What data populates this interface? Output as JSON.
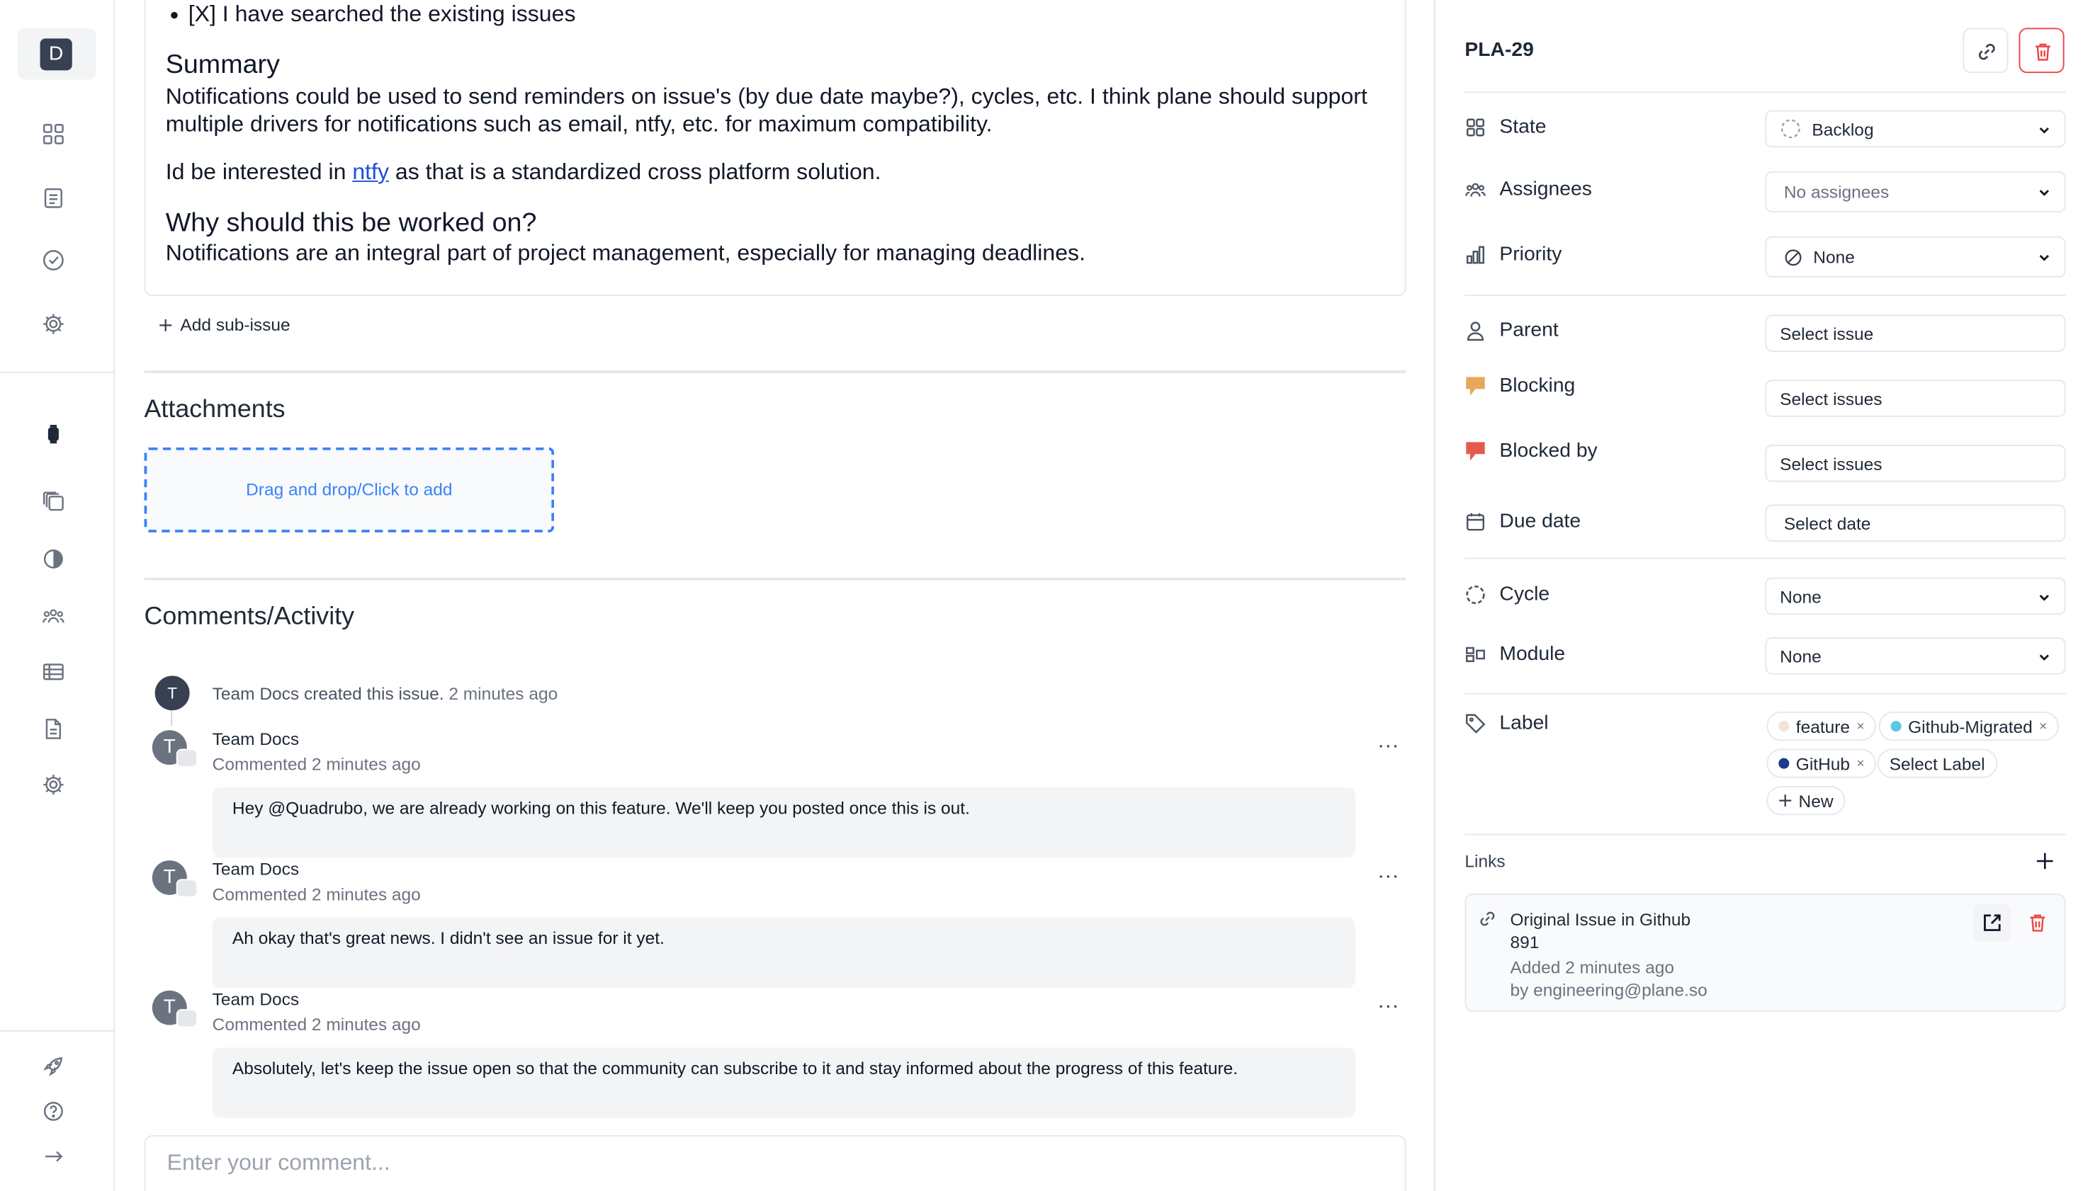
{
  "workspace": {
    "avatar_letter": "D"
  },
  "rail_icons": [
    "grid-icon",
    "clipboard-icon",
    "check-circle-icon",
    "gear-icon",
    "watch-icon",
    "layers-icon",
    "contrast-icon",
    "users-icon",
    "table-icon",
    "document-icon",
    "settings-icon",
    "rocket-icon",
    "help-icon",
    "arrow-right-icon"
  ],
  "description": {
    "checklist_item": "[X] I have searched the existing issues",
    "summary_heading": "Summary",
    "summary_text": "Notifications could be used to send reminders on issue's (by due date maybe?), cycles, etc. I think plane should support multiple drivers for notifications such as email, ntfy, etc. for maximum compatibility.",
    "interest_prefix": "Id be interested in",
    "interest_link": "ntfy",
    "interest_suffix": "as that is a standardized cross platform solution.",
    "why_heading": "Why should this be worked on?",
    "why_text": "Notifications are an integral part of project management, especially for managing deadlines."
  },
  "sub_issue": {
    "add_label": "Add sub-issue"
  },
  "attachments": {
    "heading": "Attachments",
    "dropzone_label": "Drag and drop/Click to add"
  },
  "comments": {
    "heading": "Comments/Activity",
    "activity": {
      "avatar": "T",
      "actor": "Team Docs",
      "action": "created this issue.",
      "time": "2 minutes ago"
    },
    "items": [
      {
        "avatar": "T",
        "author": "Team Docs",
        "time": "Commented 2 minutes ago",
        "body": "Hey @Quadrubo, we are already working on this feature. We'll keep you posted once this is out."
      },
      {
        "avatar": "T",
        "author": "Team Docs",
        "time": "Commented 2 minutes ago",
        "body": "Ah okay that's great news. I didn't see an issue for it yet."
      },
      {
        "avatar": "T",
        "author": "Team Docs",
        "time": "Commented 2 minutes ago",
        "body": "Absolutely, let's keep the issue open so that the community can subscribe to it and stay informed about the progress of this feature."
      }
    ],
    "more_label": "...",
    "input_placeholder": "Enter your comment..."
  },
  "sidebar": {
    "issue_id": "PLA-29",
    "properties": {
      "state": {
        "label": "State",
        "value": "Backlog"
      },
      "assignees": {
        "label": "Assignees",
        "value": "No assignees"
      },
      "priority": {
        "label": "Priority",
        "value": "None"
      },
      "parent": {
        "label": "Parent",
        "value": "Select issue"
      },
      "blocking": {
        "label": "Blocking",
        "value": "Select issues"
      },
      "blocked_by": {
        "label": "Blocked by",
        "value": "Select issues"
      },
      "due_date": {
        "label": "Due date",
        "value": "Select date"
      },
      "cycle": {
        "label": "Cycle",
        "value": "None"
      },
      "module": {
        "label": "Module",
        "value": "None"
      },
      "label": {
        "label": "Label"
      }
    },
    "labels": [
      {
        "name": "feature",
        "color": "#f1e3d8",
        "remove": "×"
      },
      {
        "name": "Github-Migrated",
        "color": "#5ec5e6",
        "remove": "×"
      },
      {
        "name": "GitHub",
        "color": "#1e3a8a",
        "remove": "×"
      }
    ],
    "select_label": "Select Label",
    "new_label": "New",
    "links": {
      "heading": "Links",
      "items": [
        {
          "title": "Original Issue in Github 891",
          "added": "Added 2 minutes ago",
          "by": "by engineering@plane.so"
        }
      ]
    }
  },
  "colors": {
    "danger": "#ef4444",
    "link": "#1d4ed8",
    "dropzone": "#3b82f6",
    "blocking": "#e8a75a",
    "blocked_by": "#e55a4e"
  }
}
